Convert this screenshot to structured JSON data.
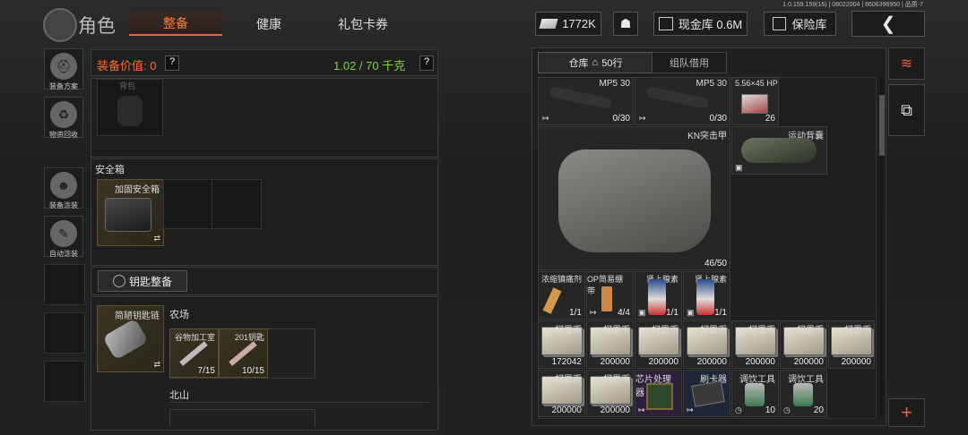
{
  "version_text": "1.0.159.159(16) | 08022004 | 8606396950 | 品质-7",
  "header": {
    "title": "角色",
    "tabs": [
      {
        "label": "整备",
        "active": true
      },
      {
        "label": "健康",
        "active": false
      },
      {
        "label": "礼包卡券",
        "active": false
      }
    ],
    "currency": "1772K",
    "cash_store_label": "现金库 0.6M",
    "insurance_label": "保险库"
  },
  "left_sidebar": [
    {
      "label": "装备方案"
    },
    {
      "label": "物资回收"
    },
    {
      "label": "装备涂装"
    },
    {
      "label": "自动涂装"
    }
  ],
  "loadout": {
    "value_label": "装备价值: 0",
    "weight": "1.02 / 70 千克",
    "help": "?",
    "truncated_label": "背包",
    "secure_box_title": "安全箱",
    "secure_box_item": "加固安全箱",
    "key_section_button": "钥匙整备",
    "key_case_item": "简陋钥匙链",
    "farm_label": "农场",
    "keys": [
      {
        "name": "谷物加工室",
        "count": "7/15"
      },
      {
        "name": "201钥匙",
        "count": "10/15"
      }
    ],
    "north_mountain_label": "北山"
  },
  "warehouse": {
    "tab_storage": "仓库",
    "rows_label": "50行",
    "tab_team": "组队借用",
    "items": [
      {
        "name": "MP5 30",
        "count": "0/30"
      },
      {
        "name": "MP5 30",
        "count": "0/30"
      },
      {
        "name": "5.56×45 HP",
        "count": "26"
      },
      {
        "name": "KN突击甲",
        "count": "46/50"
      },
      {
        "name": "运动背囊",
        "count": ""
      },
      {
        "name": "浓缩镇痛剂",
        "count": "1/1"
      },
      {
        "name": "OP简易绷带",
        "count": "4/4"
      },
      {
        "name": "肾上腺素",
        "count": "1/1"
      },
      {
        "name": "肾上腺素",
        "count": "1/1"
      },
      {
        "name": "柯恩币",
        "count": "172042"
      },
      {
        "name": "柯恩币",
        "count": "200000"
      },
      {
        "name": "柯恩币",
        "count": "200000"
      },
      {
        "name": "柯恩币",
        "count": "200000"
      },
      {
        "name": "柯恩币",
        "count": "200000"
      },
      {
        "name": "柯恩币",
        "count": "200000"
      },
      {
        "name": "柯恩币",
        "count": "200000"
      },
      {
        "name": "柯恩币",
        "count": "200000"
      },
      {
        "name": "柯恩币",
        "count": "200000"
      },
      {
        "name": "芯片处理器",
        "count": ""
      },
      {
        "name": "刷卡器",
        "count": ""
      },
      {
        "name": "调饮工具",
        "count": "10"
      },
      {
        "name": "调饮工具",
        "count": "20"
      }
    ]
  },
  "colors": {
    "accent": "#e8643a",
    "weight_green": "#7ed63c",
    "value_orange": "#ff6b2a",
    "red": "#e24b3b"
  }
}
